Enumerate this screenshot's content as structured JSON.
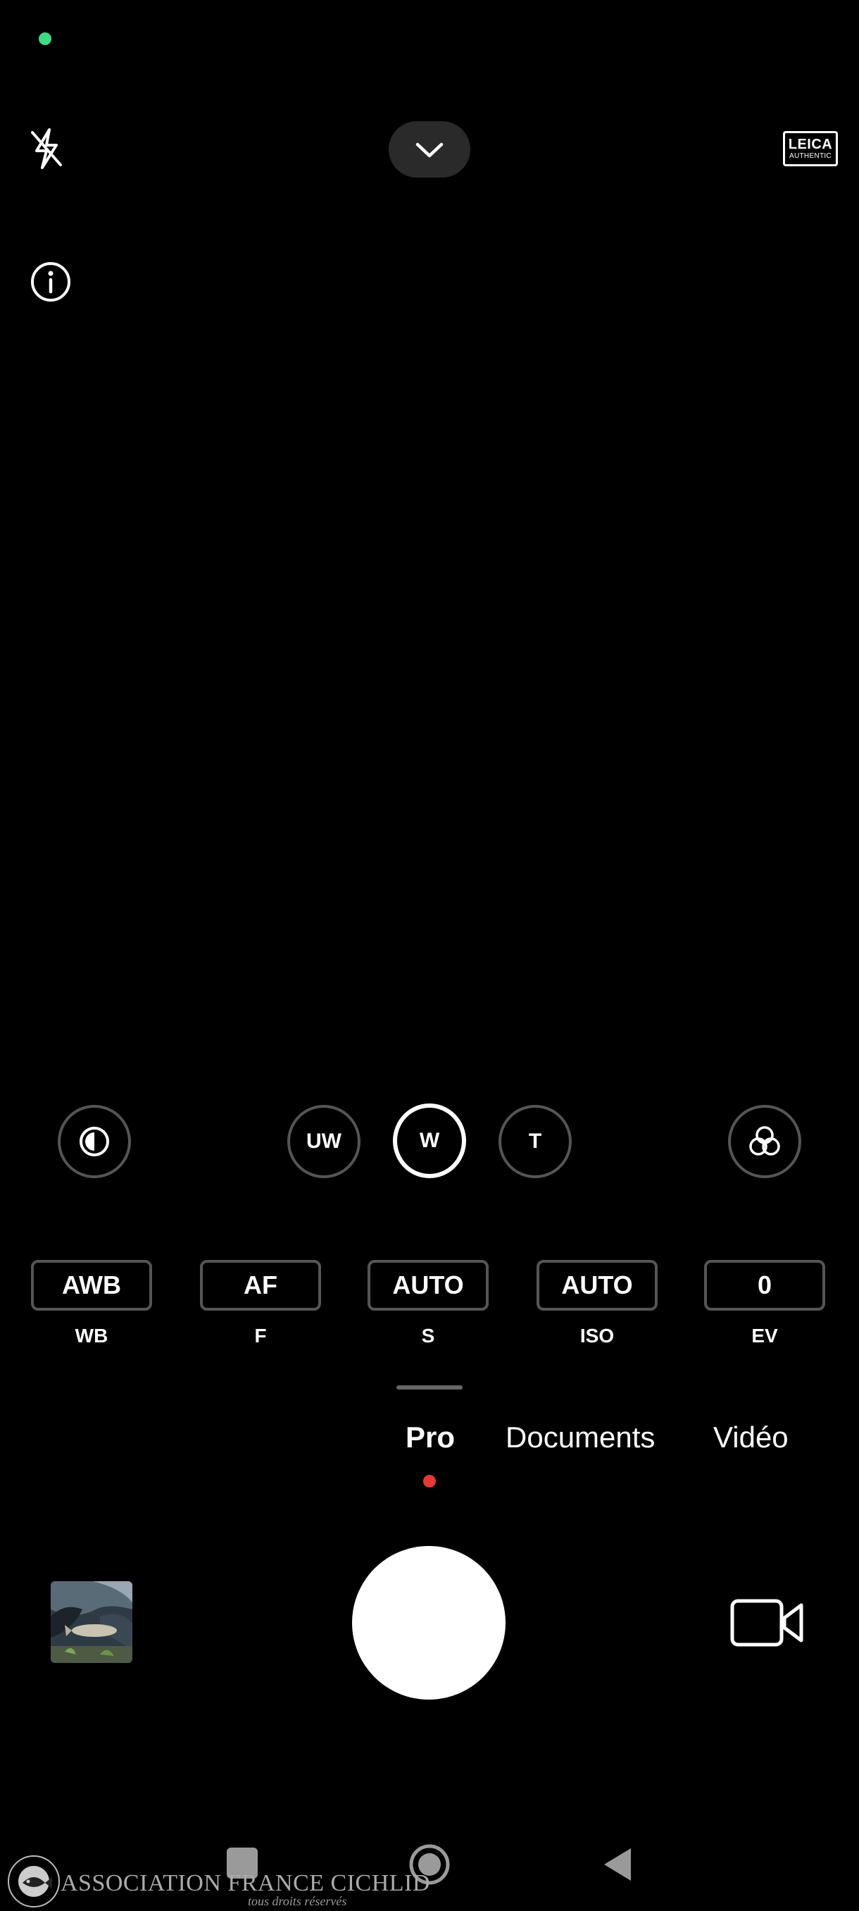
{
  "status": {
    "indicator_color": "#3ddc84"
  },
  "top_bar": {
    "flash_icon": "flash-off-icon",
    "expand_icon": "chevron-down-icon",
    "leica_line1": "LEICA",
    "leica_line2": "AUTHENTIC",
    "info_icon": "info-icon"
  },
  "lens_row": {
    "left_icon": "contrast-icon",
    "lenses": [
      {
        "label": "UW",
        "active": false
      },
      {
        "label": "W",
        "active": true
      },
      {
        "label": "T",
        "active": false
      }
    ],
    "right_icon": "filters-icon"
  },
  "pro_params": [
    {
      "value": "AWB",
      "label": "WB"
    },
    {
      "value": "AF",
      "label": "F"
    },
    {
      "value": "AUTO",
      "label": "S"
    },
    {
      "value": "AUTO",
      "label": "ISO"
    },
    {
      "value": "0",
      "label": "EV"
    }
  ],
  "modes": [
    {
      "label": "Pro",
      "active": true
    },
    {
      "label": "Documents",
      "active": false
    },
    {
      "label": "Vidéo",
      "active": false
    }
  ],
  "mode_indicator_color": "#e53935",
  "capture": {
    "thumbnail": "gallery-thumbnail",
    "video_icon": "video-camera-icon"
  },
  "navbar": {
    "recents": "recents-icon",
    "home": "home-icon",
    "back": "back-icon"
  },
  "watermark": {
    "logo_text": "ASSOCIATION FRANCE CICHLID",
    "main": "ASSOCIATION FRANCE CICHLID",
    "sub": "tous droits réservés"
  }
}
